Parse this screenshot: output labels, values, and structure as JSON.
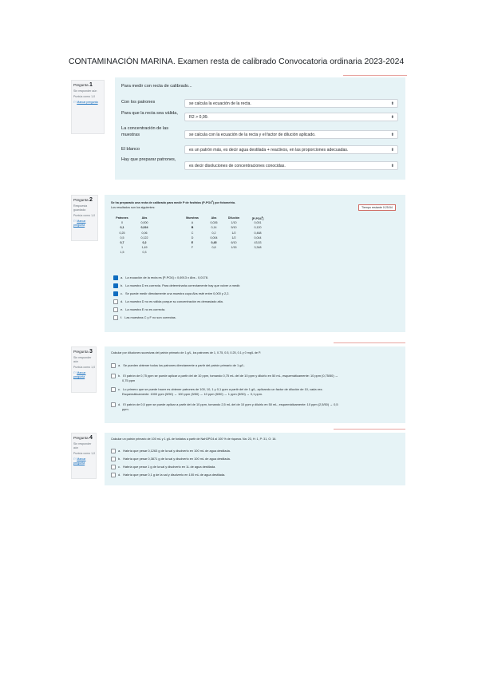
{
  "title": "CONTAMINACIÓN MARINA. Examen resta de calibrado Convocatoria ordinaria 2023-2024",
  "q1": {
    "info": {
      "prefix": "Pregunta",
      "number": "1",
      "status": "Sin responder aún",
      "score": "Puntúa como 1,0",
      "flag": "Marcar pregunta"
    },
    "intro": "Para medir con recta de calibrado...",
    "rows": [
      {
        "label": "Con los patrones",
        "value": "se calcula la ecuación de la recta."
      },
      {
        "label": "Para que la recta sea válida,",
        "value": "R2 > 0,99."
      },
      {
        "label": "La concentración de las muestras",
        "value": "se calcula con la ecuación de la recta y el factor de dilución aplicado."
      },
      {
        "label": "El blanco",
        "value": "es un patrón más, es decir agua destilada + reactivos, en las proporciones adecuadas."
      },
      {
        "label": "Hay que preparar patrones,",
        "value": "es decir disoluciones de concentraciones conocidas."
      }
    ]
  },
  "q2": {
    "info": {
      "prefix": "Pregunta",
      "number": "2",
      "status": "Respuesta guardada",
      "score": "Puntúa como 1,0",
      "flag": "Marcar pregunta"
    },
    "text1": "Se ha preparado una recta de calibrado para medir P de fosfatos (P-PO4",
    "text1b": ") por fotometría.",
    "text2": "Los resultados son los siguientes:",
    "timer": "Tiempo restante 0:25:54",
    "left_table": {
      "headers": [
        "Patrones",
        "Abs"
      ],
      "rows": [
        [
          "0",
          "0,000"
        ],
        [
          "0,1",
          "0,024"
        ],
        [
          "0,25",
          "0,06"
        ],
        [
          "0,5",
          "0,122"
        ],
        [
          "0,7",
          "0,2"
        ],
        [
          "1",
          "1,49"
        ],
        [
          "1,5",
          "0,3"
        ]
      ]
    },
    "right_table": {
      "headers": [
        "Muestras",
        "Abs",
        "Dilución",
        "[P-PO4",
        "]"
      ],
      "rows": [
        [
          "A",
          "0,026",
          "1/10",
          "0,001"
        ],
        [
          "B",
          "0,14",
          "5/10",
          "0,120"
        ],
        [
          "C",
          "0,2",
          "1/2",
          "0,468"
        ],
        [
          "D",
          "0,004",
          "1/2",
          "0,044"
        ],
        [
          "E",
          "0,45",
          "6/10",
          "43,53"
        ],
        [
          "F",
          "0,8",
          "1/15",
          "3,348"
        ]
      ]
    },
    "options": [
      {
        "letter": "a.",
        "text": "La ecuación de la recta es [P-PO4] = 0,6913 x Abs - 0,0178.",
        "checked": true
      },
      {
        "letter": "b.",
        "text": "La muestra D es correcta. Para determinarla correctamente hay que volver a medir.",
        "checked": true
      },
      {
        "letter": "c.",
        "text": "Se puede medir directamente una muestra cuya Abs esté entre 0,000 y 2,2.",
        "checked": true
      },
      {
        "letter": "d.",
        "text": "La muestra D no es válida porque su concentración es demasiado alta.",
        "checked": false
      },
      {
        "letter": "e.",
        "text": "La muestra E no es correcta.",
        "checked": false
      },
      {
        "letter": "f.",
        "text": "Las muestras C y F no son correctas.",
        "checked": false
      }
    ]
  },
  "q3": {
    "info": {
      "prefix": "Pregunta",
      "number": "3",
      "status": "Sin responder aún",
      "score": "Puntúa como 1,0",
      "flag": "Marcar pregunta"
    },
    "question": "Calcular por diluciones sucesivas del patrón primario de 1 g/L, los patrones de 1, 0.75, 0.5, 0.25, 0.1 y 0 mg/L de P.",
    "options": [
      {
        "letter": "a.",
        "lines": [
          "Se pueden obtener todos los patrones directamente a partir del patrón primario de 1 g/L."
        ]
      },
      {
        "letter": "b.",
        "lines": [
          "El patrón de 0,75 ppm se puede aplicar a partir del de 10 ppm, tomando 0,75 mL del de 10 ppm y diluirlo en 50 mL, esquemáticamente: 10 ppm (0,75/50) →",
          "0,75 ppm"
        ]
      },
      {
        "letter": "c.",
        "lines": [
          "Lo primero que se puede hacer es obtener patrones de 100, 10, 1 y 0,1 ppm a partir del de 1 g/L, aplicando un factor de dilución de 10, cada vez.",
          "Esquemáticamente: 1000 ppm (5/50) → 100 ppm (5/50) → 10 ppm (5/50) → 1 ppm (5/50) → 0,1 ppm."
        ]
      },
      {
        "letter": "d.",
        "lines": [
          "El patrón de 0,5 ppm se puede aplicar a partir del de 10 ppm, tomando 2,5 mL del de 10 ppm y diluirlo en 50 mL, esquemáticamente: 10 ppm (2,5/50) → 0,5",
          "ppm."
        ]
      }
    ]
  },
  "q4": {
    "info": {
      "prefix": "Pregunta",
      "number": "4",
      "status": "Sin responder aún",
      "score": "Puntúa como 1,0",
      "flag": "Marcar pregunta"
    },
    "question": "Calcular un patrón primario de 100 mL y 1 g/L de fosfatos a partir de NaH2PO4 al 100 % de riqueza. Na: 23, H: 1, P: 31, O: 16.",
    "options": [
      {
        "letter": "a.",
        "text": "Habría que pesar 0,1263 g de la sal y disolverlo en 100 mL de agua destilada."
      },
      {
        "letter": "b.",
        "text": "Habría que pesar 0,3871 g de la sal y disolverlo en 100 mL de agua destilada."
      },
      {
        "letter": "c.",
        "text": "Habría que pesar 1 g de la sal y disolverlo en 1L de agua destilada."
      },
      {
        "letter": "d.",
        "text": "Habría que pesar 0,1 g de la sal y disolverlo en 100 mL de agua destilada."
      }
    ]
  }
}
